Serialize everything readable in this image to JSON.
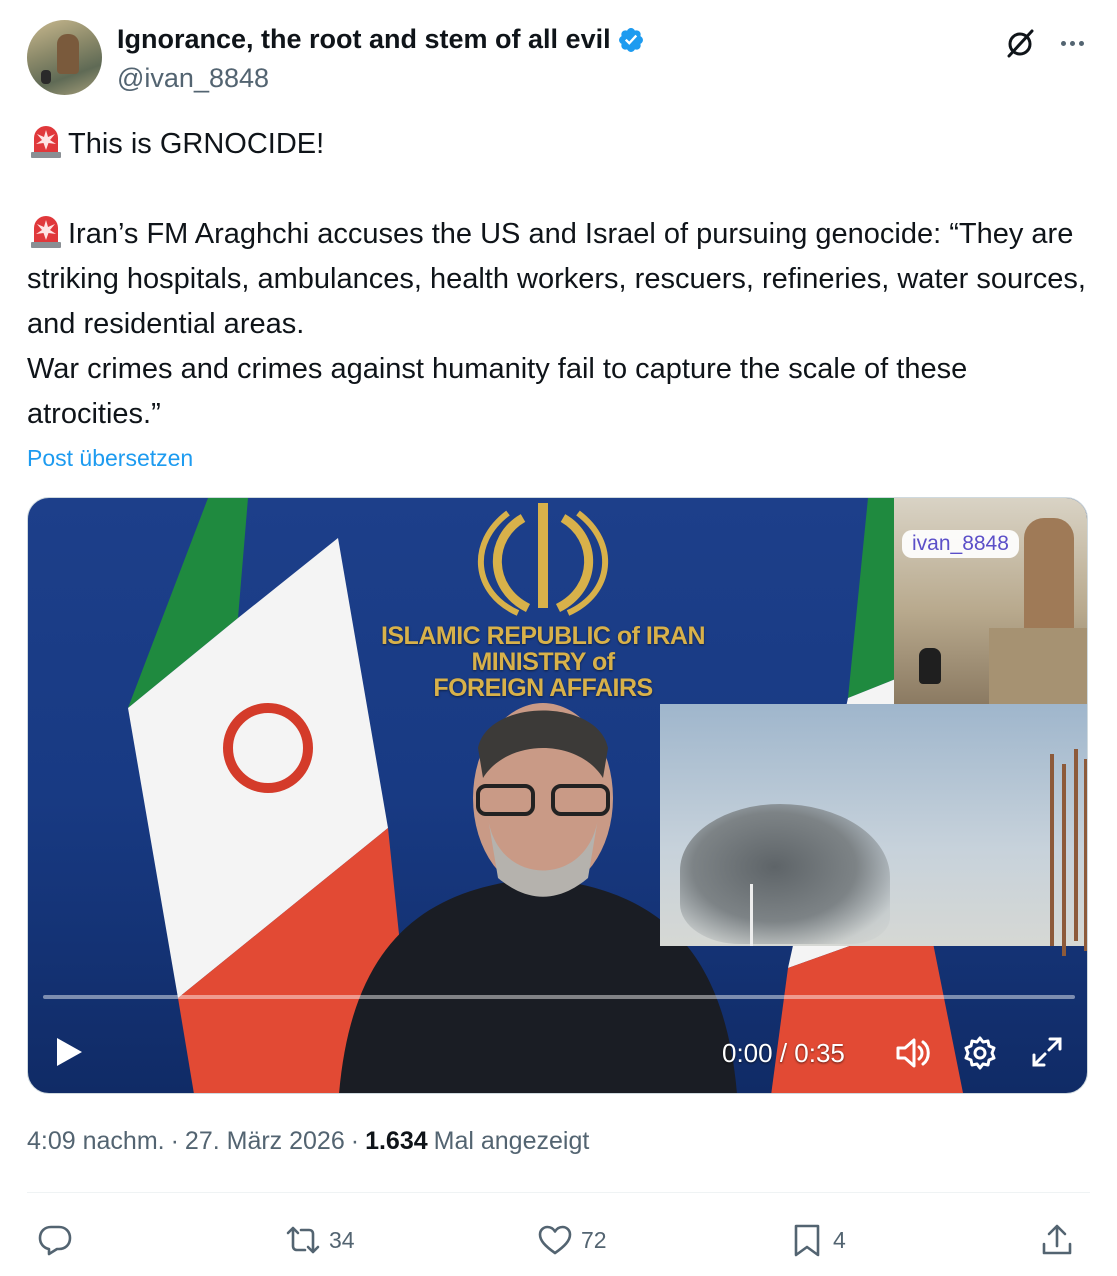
{
  "author": {
    "display_name": "Ignorance, the root and stem of all evil",
    "handle": "@ivan_8848",
    "verified": true
  },
  "header_icons": [
    "grok-icon",
    "more-icon"
  ],
  "tweet": {
    "line1": "This is GRNOCIDE!",
    "line2": "Iran’s FM Araghchi accuses the US and Israel of pursuing genocide: “They are striking hospitals, ambulances, health workers, rescuers, refineries, water sources, and residential areas.\nWar crimes and crimes against humanity fail to capture the scale of these atrocities.”",
    "emoji": "siren-icon"
  },
  "translate_link": "Post übersetzen",
  "video": {
    "emblem_text": "ISLAMIC REPUBLIC of IRAN\nMINISTRY of\nFOREIGN AFFAIRS",
    "watermark": "ivan_8848",
    "time": "0:00 / 0:35",
    "progress": 0,
    "controls": [
      "play-icon",
      "volume-icon",
      "settings-icon",
      "fullscreen-icon"
    ]
  },
  "meta": {
    "time": "4:09 nachm.",
    "date": "27. März 2026",
    "views_count": "1.634",
    "views_label": "Mal angezeigt"
  },
  "actions": {
    "reply": "",
    "repost": "34",
    "like": "72",
    "bookmark": "4"
  },
  "colors": {
    "accent": "#1d9bf0",
    "text": "#0f1419",
    "secondary": "#536471"
  }
}
